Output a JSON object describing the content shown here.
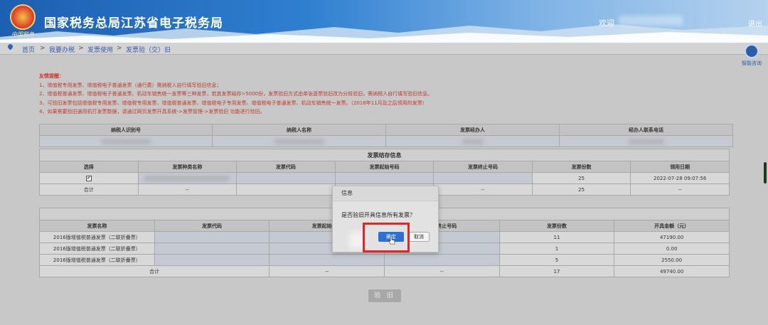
{
  "header": {
    "logo_text": "中国税务",
    "title": "国家税务总局江苏省电子税务局",
    "welcome": "欢迎",
    "logout": "退出"
  },
  "breadcrumb": {
    "items": [
      "首页",
      "我要办税",
      "发票使用",
      "发票验（交）旧"
    ],
    "sep": ">"
  },
  "assistant": {
    "label": "智能咨询"
  },
  "tips": {
    "title": "友情提醒：",
    "lines": [
      "1、增值税专用发票、增值税电子普通发票（通行费）需纳税人自行填写验旧信息；",
      "2、增值税普通发票、增值税电子普通发票、机动车销售统一发票等三种发票，若其发票结存>5000份，发票验旧方式由单张逐票验旧改为分段验旧，需纳税人自行填写验旧信息。",
      "3、可验旧发票包括增值税专用发票、增值税专用发票、增值税普通发票、增值税电子专用发票、增值税电子普通发票、机动车销售统一发票。（2018年11月及之后领用的发票）",
      "4、如果需要验旧通用机打发票数据，请通过网页发票开具系统->发票管理->发票验旧 功能进行验旧。"
    ]
  },
  "taxpayer_table": {
    "headers": [
      "纳税人识别号",
      "纳税人名称",
      "发票经办人",
      "经办人联系电话"
    ]
  },
  "stock_table": {
    "caption": "发票结存信息",
    "headers": [
      "选择",
      "发票种类名称",
      "发票代码",
      "发票起始号码",
      "发票终止号码",
      "发票份数",
      "领用日期"
    ],
    "rows": [
      {
        "check": "✔",
        "count": "25",
        "date": "2022-07-28 09:07:56"
      }
    ],
    "total": {
      "label": "合计",
      "name": "--",
      "end": "--",
      "count": "25",
      "date": "--"
    }
  },
  "invoice_table": {
    "headers": [
      "发票名称",
      "发票代码",
      "发票起始号码",
      "发票终止号码",
      "发票份数",
      "开具金额（元）"
    ],
    "rows": [
      {
        "name": "2016版增值税普通发票（二联折叠票）",
        "count": "11",
        "amount": "47190.00"
      },
      {
        "name": "2016版增值税普通发票（二联折叠票）",
        "count": "1",
        "amount": "0.00"
      },
      {
        "name": "2016版增值税普通发票（二联折叠票）",
        "count": "5",
        "amount": "2550.00"
      }
    ],
    "total": {
      "label": "合计",
      "code": "--",
      "end": "--",
      "count": "17",
      "amount": "49740.00"
    }
  },
  "verify_button": "验 旧",
  "dialog": {
    "title": "信息",
    "message": "是否验旧开具信息所有发票？",
    "ok": "确定",
    "cancel": "取消"
  },
  "colors": {
    "header_blue": "#2f7fd0",
    "tip_red": "#c3392b",
    "ok_blue": "#2f6fcd",
    "highlight_red": "#e0262b"
  }
}
